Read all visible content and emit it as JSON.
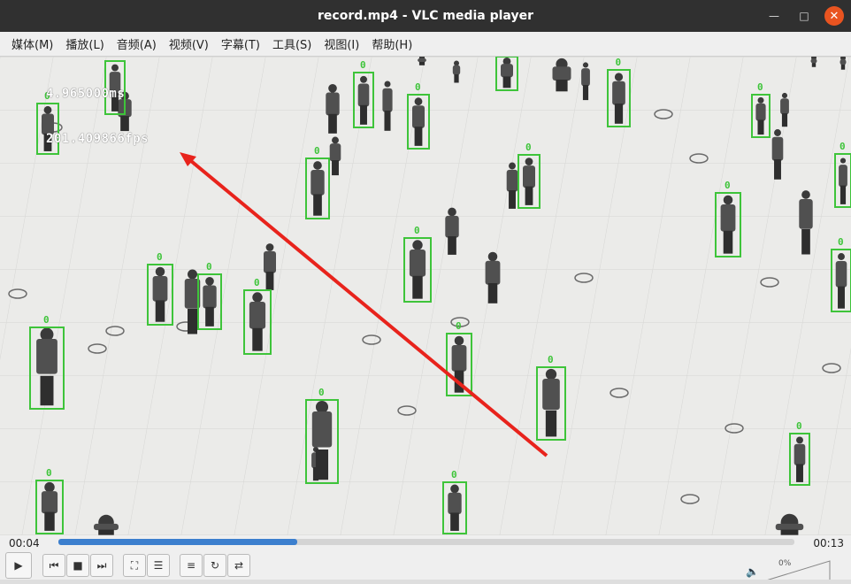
{
  "window": {
    "title": "record.mp4 - VLC media player"
  },
  "menu": [
    "媒体(M)",
    "播放(L)",
    "音频(A)",
    "视频(V)",
    "字幕(T)",
    "工具(S)",
    "视图(I)",
    "帮助(H)"
  ],
  "video": {
    "overlay_time": "4.965000ms",
    "overlay_fps": "201.409866fps",
    "detection_label": "0",
    "box_color": "#3ec43a",
    "arrow_color": "#e8231c"
  },
  "playback": {
    "elapsed": "00:04",
    "total": "00:13",
    "progress": 0.325
  },
  "volume": {
    "percent": "0%"
  },
  "icons": {
    "play": "play-icon",
    "previous": "skip-back-icon",
    "stop": "stop-icon",
    "next": "skip-forward-icon",
    "fullscreen": "fullscreen-icon",
    "extended": "equalizer-icon",
    "playlist": "playlist-icon",
    "loop": "loop-icon",
    "shuffle": "shuffle-icon",
    "volume": "speaker-icon"
  }
}
